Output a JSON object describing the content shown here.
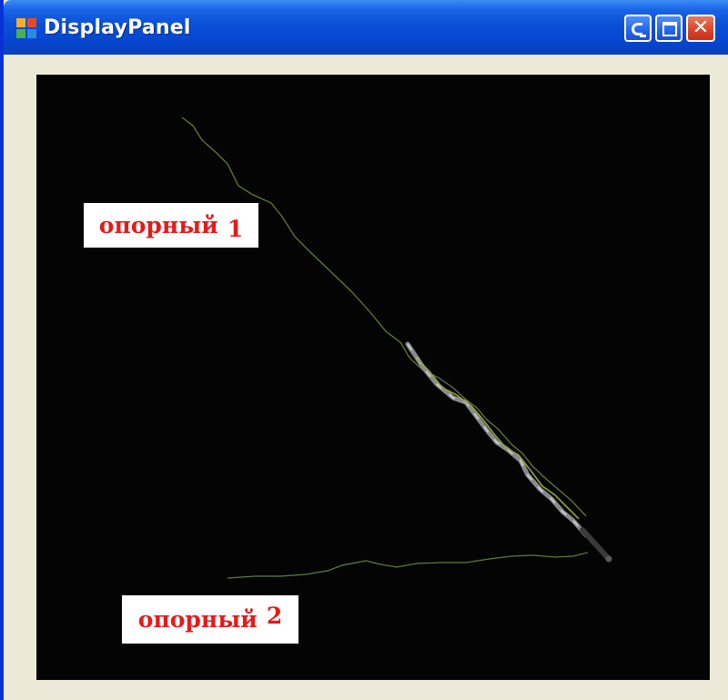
{
  "window": {
    "title": "DisplayPanel",
    "icon": "app-window-icon",
    "buttons": [
      "minimize",
      "maximize",
      "close"
    ]
  },
  "display": {
    "background_color": "#040404",
    "trace_color": "#6f8a3a",
    "track_color": "#9a9a9a",
    "labels": [
      {
        "word": "опорный",
        "number": "1"
      },
      {
        "word": "опорный",
        "number": "2"
      }
    ],
    "label_text_color": "#e41b1b"
  }
}
